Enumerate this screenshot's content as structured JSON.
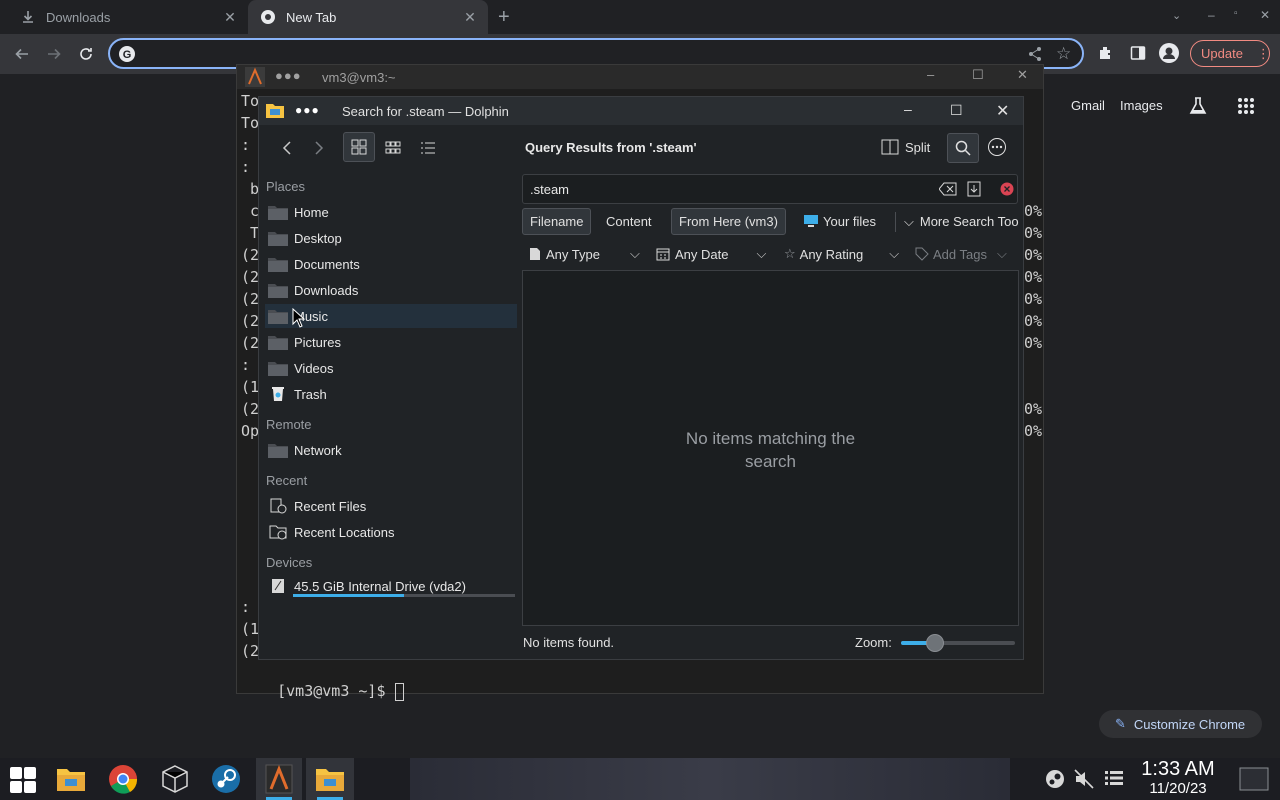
{
  "chrome": {
    "tabs": [
      {
        "label": "Downloads",
        "icon": "download-icon"
      },
      {
        "label": "New Tab",
        "icon": "chrome-icon"
      }
    ],
    "update_label": "Update",
    "links": [
      "Gmail",
      "Images"
    ],
    "customize_label": "Customize Chrome"
  },
  "terminal": {
    "title": "vm3@vm3:~",
    "left_fragments": [
      "To",
      "To",
      ": :",
      ": :",
      " b",
      " c",
      " T",
      "(2",
      "(2",
      "(2",
      "(2",
      "(2",
      ": :",
      "(1",
      "(2",
      "Op"
    ],
    "right_fragments": [
      "0%",
      "0%",
      "0%",
      "0%",
      "0%",
      "0%",
      "0%",
      "0%",
      "0%"
    ],
    "bottom_fragments": [
      ": :",
      "(1",
      "(2"
    ],
    "prompt": "[vm3@vm3 ~]$ "
  },
  "dolphin": {
    "title": "Search for .steam — Dolphin",
    "header": "Query Results from '.steam'",
    "split_label": "Split",
    "search_value": ".steam",
    "chips": [
      "Filename",
      "Content",
      "From Here (vm3)",
      "Your files",
      "More Search Too"
    ],
    "filters": [
      "Any Type",
      "Any Date",
      "Any Rating",
      "Add Tags"
    ],
    "empty_message_line1": "No items matching the",
    "empty_message_line2": "search",
    "status": "No items found.",
    "zoom_label": "Zoom:",
    "zoom_level": 0.3,
    "places_heading": "Places",
    "places": [
      "Home",
      "Desktop",
      "Documents",
      "Downloads",
      "Music",
      "Pictures",
      "Videos",
      "Trash"
    ],
    "remote_heading": "Remote",
    "remote": [
      "Network"
    ],
    "recent_heading": "Recent",
    "recent": [
      "Recent Files",
      "Recent Locations"
    ],
    "devices_heading": "Devices",
    "device": "45.5 GiB Internal Drive (vda2)",
    "device_usage": 0.5
  },
  "taskbar": {
    "time": "1:33 AM",
    "date": "11/20/23"
  },
  "colors": {
    "accent": "#3daee9",
    "chrome_blue": "#8ab4f8",
    "update_red": "#f28b82"
  }
}
